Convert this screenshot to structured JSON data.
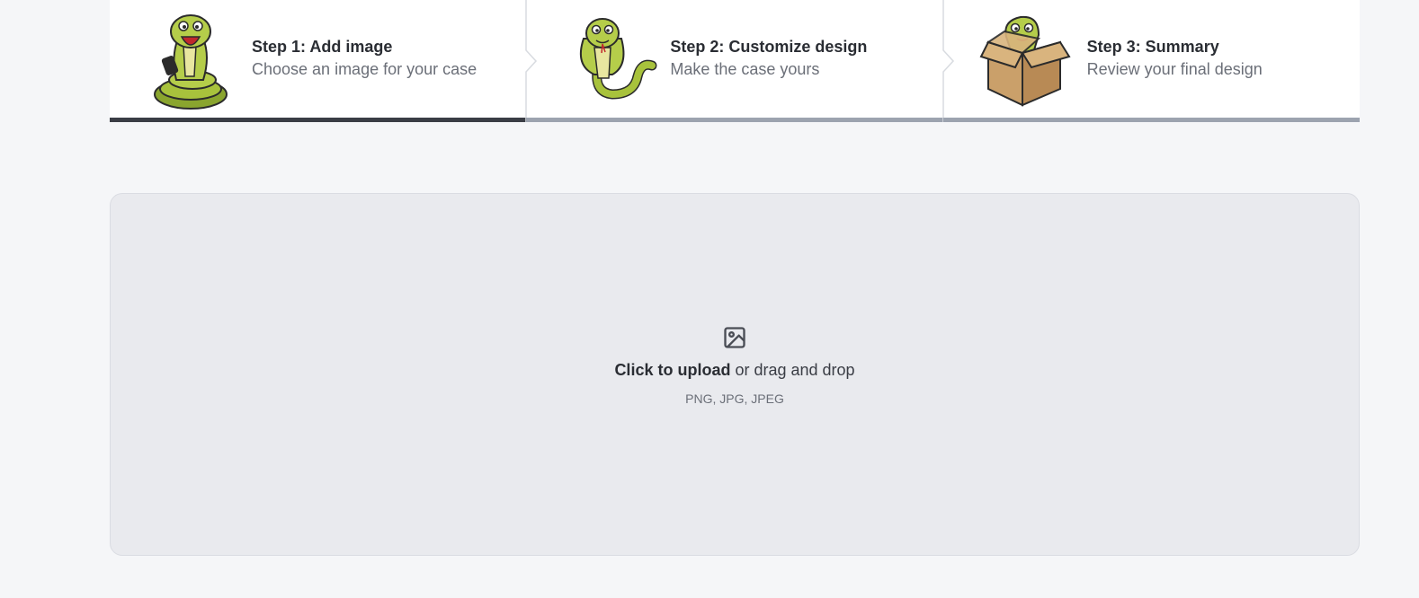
{
  "steps": [
    {
      "title": "Step 1: Add image",
      "subtitle": "Choose an image for your case",
      "illustration": "snake-holding-phone-icon",
      "active": true
    },
    {
      "title": "Step 2: Customize design",
      "subtitle": "Make the case yours",
      "illustration": "cobra-snake-icon",
      "active": false
    },
    {
      "title": "Step 3: Summary",
      "subtitle": "Review your final design",
      "illustration": "snake-in-box-icon",
      "active": false
    }
  ],
  "upload": {
    "icon": "image-icon",
    "primary": "Click to upload",
    "secondary": " or drag and drop",
    "formats": "PNG, JPG, JPEG"
  },
  "colors": {
    "active_bar": "#3a3d45",
    "inactive_bar": "#9ca3af",
    "dropzone_bg": "#e9eaee",
    "snake_green": "#a8c23c"
  }
}
